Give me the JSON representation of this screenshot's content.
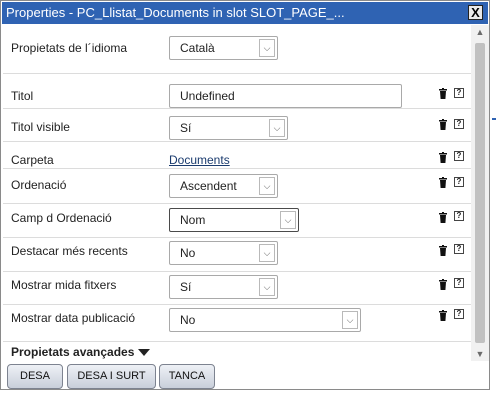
{
  "window": {
    "title": "Properties - PC_Llistat_Documents in slot SLOT_PAGE_...",
    "close_label": "X"
  },
  "language": {
    "label": "Propietats de l´idioma",
    "value": "Català"
  },
  "rows": [
    {
      "label": "Titol",
      "value": "Undefined"
    },
    {
      "label": "Titol visible",
      "value": "Sí"
    },
    {
      "label": "Carpeta",
      "value": "Documents"
    },
    {
      "label": "Ordenació",
      "value": "Ascendent"
    },
    {
      "label": "Camp d Ordenació",
      "value": "Nom"
    },
    {
      "label": "Destacar més recents",
      "value": "No"
    },
    {
      "label": "Mostrar mida fitxers",
      "value": "Sí"
    },
    {
      "label": "Mostrar data publicació",
      "value": "No"
    }
  ],
  "advanced": {
    "label": "Propietats avançades"
  },
  "icons": {
    "delete": "trash-icon",
    "help": "help-icon",
    "help_glyph": "?",
    "dropdown": "chevron-down-icon"
  },
  "buttons": {
    "save": "DESA",
    "save_exit": "DESA I SURT",
    "close": "TANCA"
  },
  "colors": {
    "titlebar": "#2f63b3",
    "link": "#1a3b6e"
  }
}
